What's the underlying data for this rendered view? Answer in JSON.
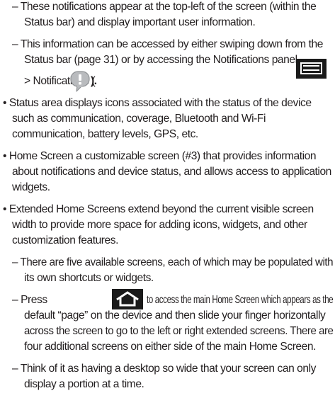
{
  "lines": [
    {
      "text": "– These notifications appear at the top-left of the screen (within the"
    },
    {
      "text": "Status bar) and display important user information."
    },
    {
      "text": "– This information can be accessed by either swiping down from the"
    },
    {
      "text": "Status bar (page 31) or by accessing the Notifications panel"
    },
    {
      "text": "> Notifications ("
    },
    {
      "text": ")."
    },
    {
      "text": "• Status area displays icons associated with the status of the device"
    },
    {
      "text": "such as communication, coverage, Bluetooth and Wi-Fi"
    },
    {
      "text": "communication, battery levels, GPS, etc."
    },
    {
      "text": "• Home Screen a customizable screen (#3) that provides information"
    },
    {
      "text": "about notifications and device status, and allows access to application"
    },
    {
      "text": "widgets."
    },
    {
      "text": "• Extended Home Screens extend beyond the current visible screen"
    },
    {
      "text": "width to provide more space for adding icons, widgets, and other"
    },
    {
      "text": "customization features."
    },
    {
      "text": "– There are five available screens, each of which may be populated with"
    },
    {
      "text": "its own shortcuts or widgets."
    },
    {
      "text": "– Press"
    },
    {
      "text": "to access the main Home Screen which appears as the"
    },
    {
      "text": "default “page” on the device and then slide your finger horizontally"
    },
    {
      "text": "across the screen to go to the left or right extended screens. There are"
    },
    {
      "text": "four additional screens on either side of the main Home Screen."
    },
    {
      "text": "– Think of it as having a desktop so wide that your screen can only"
    },
    {
      "text": "display a portion at a time."
    }
  ],
  "icons": {
    "menu_key": "menu-key-icon",
    "notifications": "notifications-icon",
    "home_key": "home-key-icon"
  }
}
